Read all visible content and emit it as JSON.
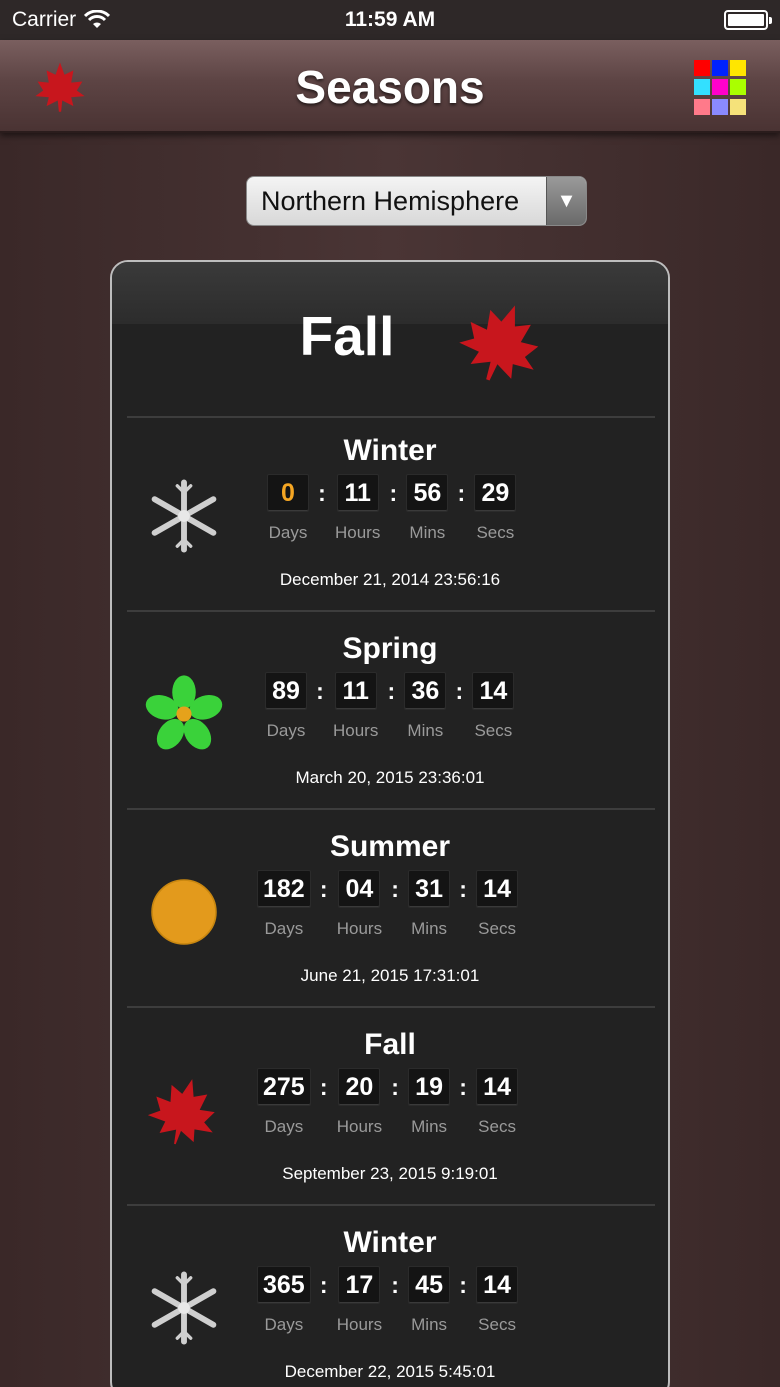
{
  "status_bar": {
    "carrier": "Carrier",
    "time": "11:59 AM"
  },
  "nav": {
    "title": "Seasons",
    "left_icon": "maple-leaf-icon",
    "right_icon": "color-grid-icon"
  },
  "hemisphere": {
    "selected": "Northern Hemisphere"
  },
  "current_season": {
    "title": "Fall"
  },
  "seasons": [
    {
      "name": "Winter",
      "icon": "snowflake-icon",
      "days": "0",
      "hours": "11",
      "mins": "56",
      "secs": "29",
      "date": "December 21, 2014  23:56:16"
    },
    {
      "name": "Spring",
      "icon": "flower-icon",
      "days": "89",
      "hours": "11",
      "mins": "36",
      "secs": "14",
      "date": "March 20, 2015  23:36:01"
    },
    {
      "name": "Summer",
      "icon": "sun-icon",
      "days": "182",
      "hours": "04",
      "mins": "31",
      "secs": "14",
      "date": "June 21, 2015  17:31:01"
    },
    {
      "name": "Fall",
      "icon": "maple-leaf-icon",
      "days": "275",
      "hours": "20",
      "mins": "19",
      "secs": "14",
      "date": "September 23, 2015  9:19:01"
    },
    {
      "name": "Winter",
      "icon": "snowflake-icon",
      "days": "365",
      "hours": "17",
      "mins": "45",
      "secs": "14",
      "date": "December 22, 2015  5:45:01"
    }
  ],
  "labels": {
    "days": "Days",
    "hours": "Hours",
    "mins": "Mins",
    "secs": "Secs"
  },
  "colors": {
    "nav_bg": "#5d4444",
    "card_bg": "#222222",
    "highlight_digit": "#f5a623",
    "leaf_red": "#c8161d",
    "flower_green": "#3ad23a",
    "sun_orange": "#e39a1c"
  }
}
